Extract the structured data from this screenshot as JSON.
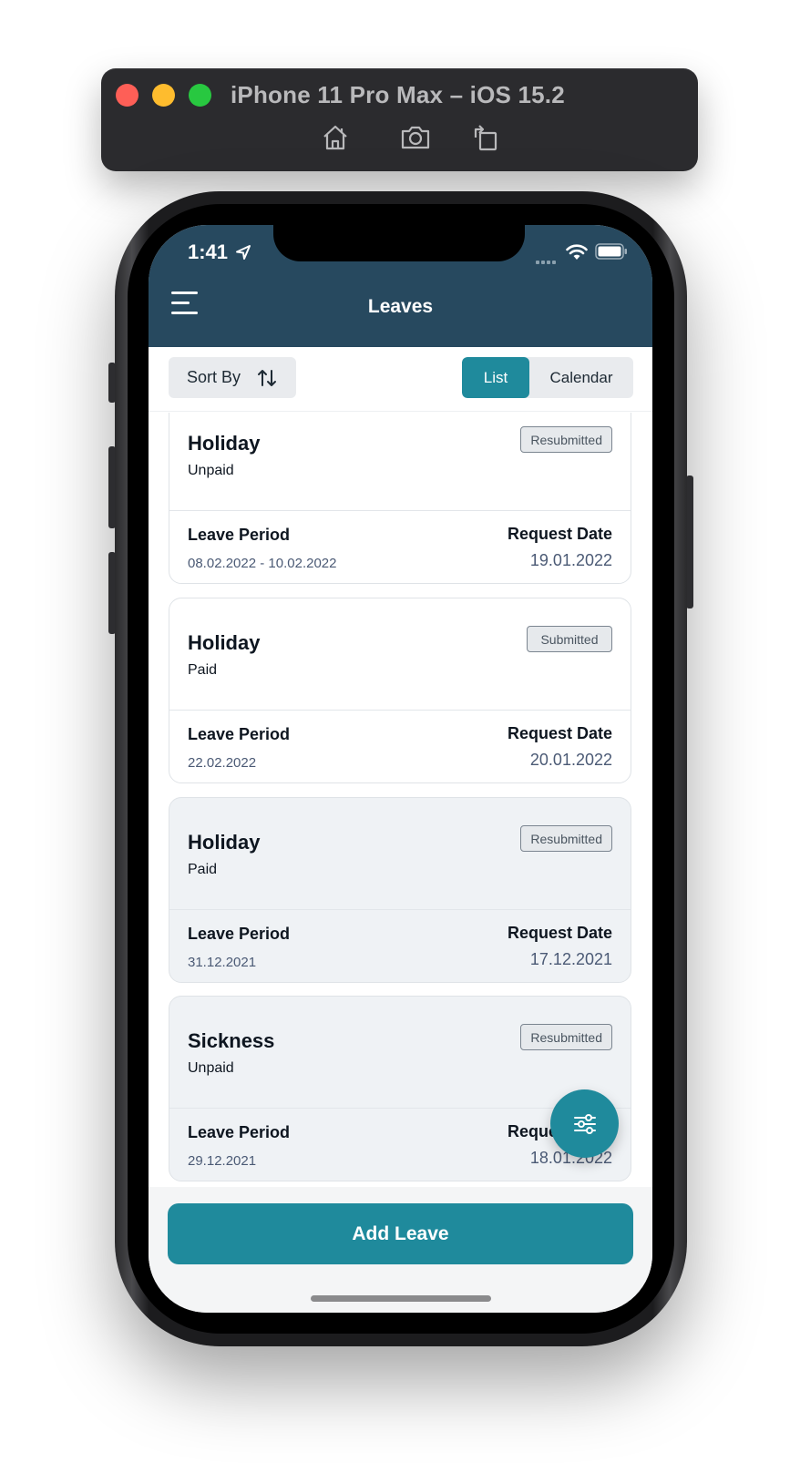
{
  "simulator": {
    "title": "iPhone 11 Pro Max – iOS 15.2",
    "buttons": [
      "home-icon",
      "screenshot-icon",
      "rotate-icon"
    ]
  },
  "status_bar": {
    "time": "1:41",
    "icons": [
      "location-arrow-icon",
      "cellular-signal-icon",
      "wifi-icon",
      "battery-icon"
    ]
  },
  "header": {
    "title": "Leaves",
    "menu_icon": "hamburger-menu-icon"
  },
  "toolbar": {
    "sort_label": "Sort By",
    "sort_icon": "sort-arrows-icon",
    "view_options": [
      "List",
      "Calendar"
    ],
    "selected_view": "List"
  },
  "labels": {
    "leave_period": "Leave Period",
    "request_date": "Request Date"
  },
  "leaves": [
    {
      "type": "Holiday",
      "pay": "Unpaid",
      "status": "Resubmitted",
      "period": "08.02.2022 - 10.02.2022",
      "request_date": "19.01.2022",
      "highlighted": false
    },
    {
      "type": "Holiday",
      "pay": "Paid",
      "status": "Submitted",
      "period": "22.02.2022",
      "request_date": "20.01.2022",
      "highlighted": false
    },
    {
      "type": "Holiday",
      "pay": "Paid",
      "status": "Resubmitted",
      "period": "31.12.2021",
      "request_date": "17.12.2021",
      "highlighted": true
    },
    {
      "type": "Sickness",
      "pay": "Unpaid",
      "status": "Resubmitted",
      "period": "29.12.2021",
      "request_date": "18.01.2022",
      "highlighted": true
    }
  ],
  "fab": {
    "icon": "filter-sliders-icon"
  },
  "footer": {
    "add_label": "Add Leave"
  },
  "colors": {
    "header": "#27495f",
    "accent": "#1f8a9c",
    "card_grey": "#eff2f5",
    "date_text": "#4b5a75"
  }
}
